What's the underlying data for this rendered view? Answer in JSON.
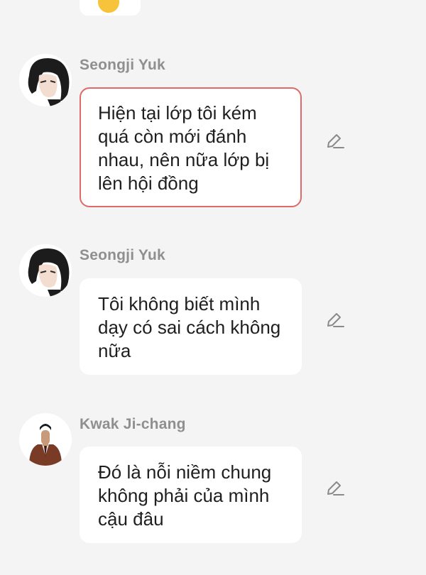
{
  "messages": [
    {
      "sender": "Seongji Yuk",
      "avatar": "seongji-avatar",
      "text": "Hiện tại lớp tôi kém quá còn mới đánh nhau, nên nữa lớp bị lên hội đồng",
      "highlighted": true,
      "action_icon": "edit-icon"
    },
    {
      "sender": "Seongji Yuk",
      "avatar": "seongji-avatar",
      "text": "Tôi không biết mình dạy có sai cách không nữa",
      "highlighted": false,
      "action_icon": "edit-icon"
    },
    {
      "sender": "Kwak Ji-chang",
      "avatar": "kwak-avatar",
      "text": "Đó là nỗi niềm chung không phải của mình cậu đâu",
      "highlighted": false,
      "action_icon": "edit-icon"
    }
  ],
  "colors": {
    "background": "#f4f4f4",
    "bubble": "#ffffff",
    "highlight_border": "#e06a6a",
    "sender_text": "#8f8f8f",
    "message_text": "#1f1f1f"
  }
}
